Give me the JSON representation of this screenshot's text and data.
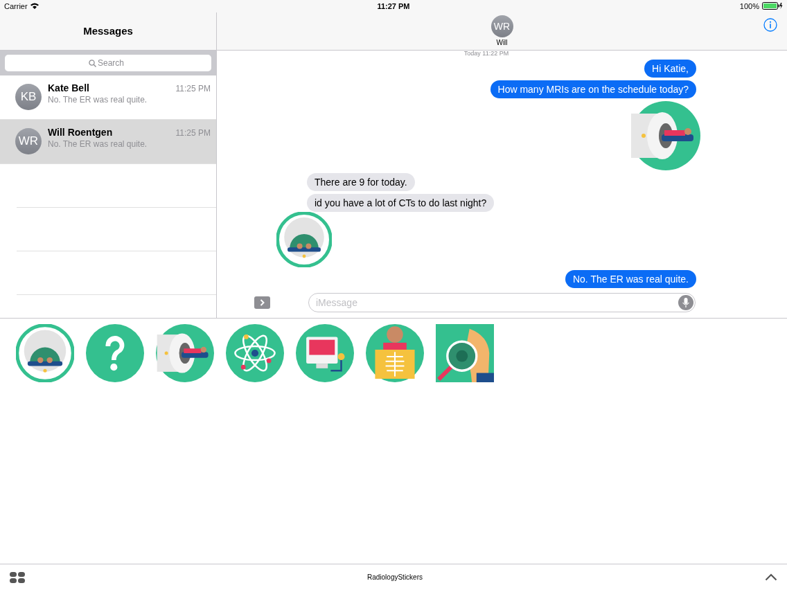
{
  "status_bar": {
    "carrier": "Carrier",
    "time": "11:27 PM",
    "battery": "100%"
  },
  "sidebar": {
    "title": "Messages",
    "search": {
      "placeholder": "Search"
    },
    "conversations": [
      {
        "initials": "KB",
        "name": "Kate Bell",
        "preview": "No. The ER was real quite.",
        "time": "11:25 PM",
        "selected": false
      },
      {
        "initials": "WR",
        "name": "Will Roentgen",
        "preview": "No. The ER was real quite.",
        "time": "11:25 PM",
        "selected": true
      }
    ]
  },
  "chat": {
    "contact": {
      "initials": "WR",
      "name": "Will"
    },
    "timestamp": "Today 11:22 PM",
    "messages": [
      {
        "kind": "text",
        "outgoing": true,
        "text": "Hi Katie,"
      },
      {
        "kind": "text",
        "outgoing": true,
        "text": "How many MRIs are on the schedule today?"
      },
      {
        "kind": "mri-side-sticker",
        "outgoing": true
      },
      {
        "kind": "text",
        "outgoing": false,
        "text": "There are 9 for today."
      },
      {
        "kind": "text",
        "outgoing": false,
        "text": "id you have a lot of CTs to do last night?"
      },
      {
        "kind": "mri-front-sticker",
        "outgoing": false
      },
      {
        "kind": "text",
        "outgoing": true,
        "text": "No. The ER was real quite."
      }
    ],
    "composer": {
      "placeholder": "iMessage"
    }
  },
  "sticker_drawer": {
    "stickers": [
      {
        "kind": "mri-front"
      },
      {
        "kind": "question"
      },
      {
        "kind": "mri-side"
      },
      {
        "kind": "atom"
      },
      {
        "kind": "monitor"
      },
      {
        "kind": "xray"
      },
      {
        "kind": "magnifier"
      }
    ],
    "app_name": "RadiologyStickers"
  }
}
